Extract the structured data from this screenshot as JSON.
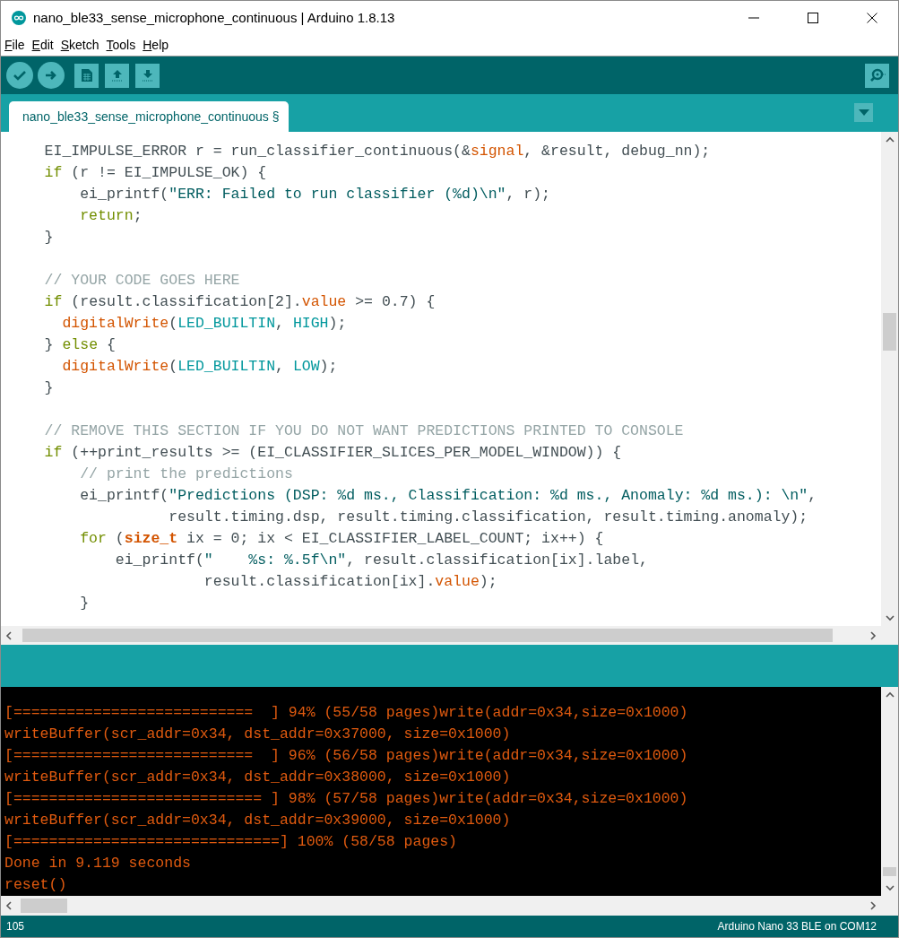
{
  "window": {
    "title": "nano_ble33_sense_microphone_continuous | Arduino 1.8.13"
  },
  "menu": [
    "File",
    "Edit",
    "Sketch",
    "Tools",
    "Help"
  ],
  "tabs": [
    {
      "label": "nano_ble33_sense_microphone_continuous §",
      "selected": true
    }
  ],
  "editor": {
    "lines": [
      {
        "kind": "code",
        "tokens": [
          {
            "kind": "plain",
            "text": "    EI_IMPULSE_ERROR r = run_classifier_continuous(&"
          },
          {
            "kind": "function",
            "text": "signal"
          },
          {
            "kind": "plain",
            "text": ", &result, debug_nn);"
          }
        ]
      },
      {
        "kind": "code",
        "tokens": [
          {
            "kind": "keyword",
            "text": "    if"
          },
          {
            "kind": "plain",
            "text": " (r != EI_IMPULSE_OK) {"
          }
        ]
      },
      {
        "kind": "code",
        "tokens": [
          {
            "kind": "plain",
            "text": "        ei_printf("
          },
          {
            "kind": "string",
            "text": "\"ERR: Failed to run classifier (%d)\\n\""
          },
          {
            "kind": "plain",
            "text": ", r);"
          }
        ]
      },
      {
        "kind": "code",
        "tokens": [
          {
            "kind": "keyword",
            "text": "        return"
          },
          {
            "kind": "plain",
            "text": ";"
          }
        ]
      },
      {
        "kind": "code",
        "tokens": [
          {
            "kind": "plain",
            "text": "    }"
          }
        ]
      },
      {
        "kind": "blank"
      },
      {
        "kind": "code",
        "tokens": [
          {
            "kind": "comment",
            "text": "    // YOUR CODE GOES HERE"
          }
        ]
      },
      {
        "kind": "code",
        "tokens": [
          {
            "kind": "keyword",
            "text": "    if"
          },
          {
            "kind": "plain",
            "text": " (result.classification[2]."
          },
          {
            "kind": "function",
            "text": "value"
          },
          {
            "kind": "plain",
            "text": " >= 0.7) {"
          }
        ]
      },
      {
        "kind": "code",
        "tokens": [
          {
            "kind": "function",
            "text": "      digitalWrite"
          },
          {
            "kind": "plain",
            "text": "("
          },
          {
            "kind": "constant",
            "text": "LED_BUILTIN"
          },
          {
            "kind": "plain",
            "text": ", "
          },
          {
            "kind": "constant",
            "text": "HIGH"
          },
          {
            "kind": "plain",
            "text": ");"
          }
        ]
      },
      {
        "kind": "code",
        "tokens": [
          {
            "kind": "plain",
            "text": "    } "
          },
          {
            "kind": "keyword",
            "text": "else"
          },
          {
            "kind": "plain",
            "text": " {"
          }
        ]
      },
      {
        "kind": "code",
        "tokens": [
          {
            "kind": "function",
            "text": "      digitalWrite"
          },
          {
            "kind": "plain",
            "text": "("
          },
          {
            "kind": "constant",
            "text": "LED_BUILTIN"
          },
          {
            "kind": "plain",
            "text": ", "
          },
          {
            "kind": "constant",
            "text": "LOW"
          },
          {
            "kind": "plain",
            "text": ");"
          }
        ]
      },
      {
        "kind": "code",
        "tokens": [
          {
            "kind": "plain",
            "text": "    }"
          }
        ]
      },
      {
        "kind": "blank"
      },
      {
        "kind": "code",
        "tokens": [
          {
            "kind": "comment",
            "text": "    // REMOVE THIS SECTION IF YOU DO NOT WANT PREDICTIONS PRINTED TO CONSOLE"
          }
        ]
      },
      {
        "kind": "code",
        "tokens": [
          {
            "kind": "keyword",
            "text": "    if"
          },
          {
            "kind": "plain",
            "text": " (++print_results >= (EI_CLASSIFIER_SLICES_PER_MODEL_WINDOW)) {"
          }
        ]
      },
      {
        "kind": "code",
        "tokens": [
          {
            "kind": "comment",
            "text": "        // print the predictions"
          }
        ]
      },
      {
        "kind": "code",
        "tokens": [
          {
            "kind": "plain",
            "text": "        ei_printf("
          },
          {
            "kind": "string",
            "text": "\"Predictions (DSP: %d ms., Classification: %d ms., Anomaly: %d ms.): \\n\""
          },
          {
            "kind": "plain",
            "text": ","
          }
        ]
      },
      {
        "kind": "code",
        "tokens": [
          {
            "kind": "plain",
            "text": "                  result.timing.dsp, result.timing.classification, result.timing.anomaly);"
          }
        ]
      },
      {
        "kind": "code",
        "tokens": [
          {
            "kind": "keyword",
            "text": "        for"
          },
          {
            "kind": "plain",
            "text": " ("
          },
          {
            "kind": "type",
            "text": "size_t"
          },
          {
            "kind": "plain",
            "text": " ix = 0; ix < EI_CLASSIFIER_LABEL_COUNT; ix++) {"
          }
        ]
      },
      {
        "kind": "code",
        "tokens": [
          {
            "kind": "plain",
            "text": "            ei_printf("
          },
          {
            "kind": "string",
            "text": "\"    %s: %.5f\\n\""
          },
          {
            "kind": "plain",
            "text": ", result.classification[ix].label,"
          }
        ]
      },
      {
        "kind": "code",
        "tokens": [
          {
            "kind": "plain",
            "text": "                      result.classification[ix]."
          },
          {
            "kind": "function",
            "text": "value"
          },
          {
            "kind": "plain",
            "text": ");"
          }
        ]
      },
      {
        "kind": "code",
        "tokens": [
          {
            "kind": "plain",
            "text": "        }"
          }
        ]
      }
    ]
  },
  "console": {
    "lines": [
      "[===========================  ] 94% (55/58 pages)write(addr=0x34,size=0x1000)",
      "writeBuffer(scr_addr=0x34, dst_addr=0x37000, size=0x1000)",
      "[===========================  ] 96% (56/58 pages)write(addr=0x34,size=0x1000)",
      "writeBuffer(scr_addr=0x34, dst_addr=0x38000, size=0x1000)",
      "[============================ ] 98% (57/58 pages)write(addr=0x34,size=0x1000)",
      "writeBuffer(scr_addr=0x34, dst_addr=0x39000, size=0x1000)",
      "[==============================] 100% (58/58 pages)",
      "Done in 9.119 seconds",
      "reset()"
    ]
  },
  "status_bar": {
    "line": "105",
    "board": "Arduino Nano 33 BLE on COM12"
  }
}
